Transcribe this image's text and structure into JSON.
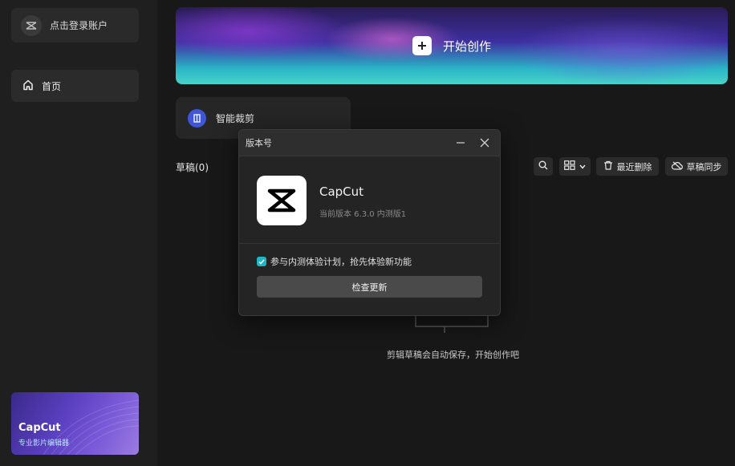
{
  "sidebar": {
    "login_label": "点击登录账户",
    "home_label": "首页",
    "promo": {
      "title": "CapCut",
      "subtitle": "专业影片编辑器"
    }
  },
  "main": {
    "hero_label": "开始创作",
    "smart_crop_label": "智能裁剪",
    "drafts_title": "草稿(0)",
    "toolbar": {
      "recent_delete_label": "最近删除",
      "sync_label": "草稿同步"
    },
    "empty_text": "剪辑草稿会自动保存，开始创作吧"
  },
  "dialog": {
    "title": "版本号",
    "app_name": "CapCut",
    "version_text": "当前版本 6.3.0 内测版1",
    "beta_label": "参与内测体验计划，抢先体验新功能",
    "beta_checked": true,
    "update_button_label": "检查更新"
  },
  "colors": {
    "accent": "#1fb6c6",
    "background": "#181818",
    "sidebar": "#1f1f1f"
  },
  "icons": [
    "capcut-logo-icon",
    "home-icon",
    "plus-icon",
    "crop-icon",
    "search-icon",
    "grid-view-icon",
    "chevron-down-icon",
    "trash-icon",
    "cloud-sync-icon",
    "minimize-icon",
    "close-icon",
    "check-icon"
  ]
}
